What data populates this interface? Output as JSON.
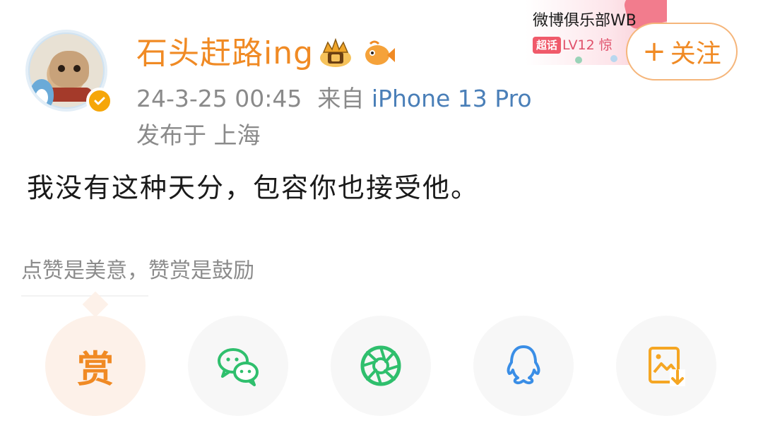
{
  "author": {
    "name": "石头赶路ing",
    "avatar": "avatar",
    "verified_icon": "verified-badge-icon",
    "badges": [
      "crown-badge-icon",
      "fish-badge-icon"
    ]
  },
  "post_meta": {
    "datetime": "24-3-25 00:45",
    "source_prefix": "来自",
    "device": "iPhone 13 Pro",
    "location": "发布于 上海"
  },
  "club": {
    "title": "微博俱乐部WB",
    "tag": "超话",
    "level": "LV12 惊"
  },
  "follow": {
    "plus": "+",
    "label": "关注"
  },
  "post": {
    "text": "我没有这种天分，包容你也接受他。"
  },
  "reward": {
    "hint": "点赞是美意，赞赏是鼓励",
    "button_char": "赏"
  },
  "share_targets": [
    {
      "icon": "wechat-icon"
    },
    {
      "icon": "moments-icon"
    },
    {
      "icon": "qq-icon"
    },
    {
      "icon": "save-image-icon"
    }
  ],
  "colors": {
    "accent_orange": "#f08a24",
    "link_blue": "#4a7fb8",
    "wechat_green": "#2fbf6d",
    "qq_blue": "#3a8ee6",
    "meta_gray": "#8a8a8a"
  }
}
